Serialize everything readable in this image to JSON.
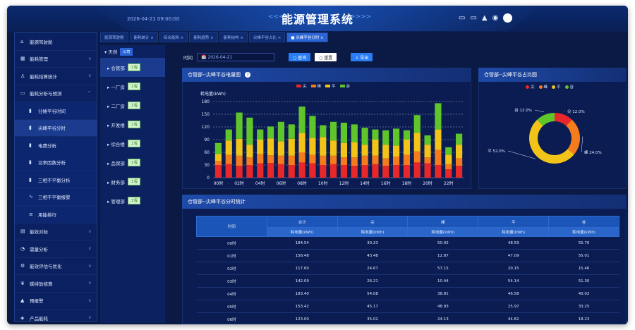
{
  "header": {
    "datetime": "2026-04-21 09:00:00",
    "title": "能源管理系统",
    "arrows_left": "<<<<",
    "arrows_right": ">>>>"
  },
  "sidebar": {
    "items": [
      {
        "label": "能源驾驶舱",
        "icon": "home-icon",
        "type": "top"
      },
      {
        "label": "能耗管理",
        "icon": "grid-icon",
        "type": "top",
        "chevron": "v"
      },
      {
        "label": "能耗结算统计",
        "icon": "user-icon",
        "type": "top",
        "chevron": "v"
      },
      {
        "label": "能耗分析与预测",
        "icon": "monitor-icon",
        "type": "top",
        "chevron": "^"
      },
      {
        "label": "分摊平谷时间",
        "icon": "bar-chart-icon",
        "type": "sub"
      },
      {
        "label": "尖峰平谷分时",
        "icon": "bar-chart-icon",
        "type": "sub",
        "active": true
      },
      {
        "label": "电费分析",
        "icon": "bar-chart-icon",
        "type": "sub"
      },
      {
        "label": "功率因数分析",
        "icon": "bar-chart-icon",
        "type": "sub"
      },
      {
        "label": "三相不平衡分析",
        "icon": "bar-chart-icon",
        "type": "sub"
      },
      {
        "label": "三相不平衡报警",
        "icon": "wave-icon",
        "type": "sub"
      },
      {
        "label": "用能排行",
        "icon": "list-icon",
        "type": "sub"
      },
      {
        "label": "能效对标",
        "icon": "book-icon",
        "type": "top",
        "chevron": "v"
      },
      {
        "label": "需量分析",
        "icon": "gauge-icon",
        "type": "top",
        "chevron": "v"
      },
      {
        "label": "能效评估与优化",
        "icon": "gear-icon",
        "type": "top",
        "chevron": "v"
      },
      {
        "label": "碳排放核算",
        "icon": "leaf-icon",
        "type": "top",
        "chevron": "v"
      },
      {
        "label": "预报警",
        "icon": "bell-icon",
        "type": "top",
        "chevron": "v"
      },
      {
        "label": "产品能耗",
        "icon": "box-icon",
        "type": "top",
        "chevron": "v"
      }
    ]
  },
  "tabs": [
    {
      "label": "能源驾驶舱"
    },
    {
      "label": "能耗统计 ×"
    },
    {
      "label": "综合能耗 ×"
    },
    {
      "label": "能耗趋势 ×"
    },
    {
      "label": "能耗结构 ×"
    },
    {
      "label": "尖峰平谷占比 ×"
    },
    {
      "label": "■ 尖峰平谷分时 ×",
      "active": true
    }
  ],
  "tree": {
    "root": {
      "label": "▾ 天然",
      "badge": "公司"
    },
    "nodes": [
      {
        "label": "▸ 仓管部",
        "badge": "工程",
        "selected": true
      },
      {
        "label": "▸ 一厂房",
        "badge": "工程"
      },
      {
        "label": "▸ 二厂房",
        "badge": "工程"
      },
      {
        "label": "▸ 开发楼",
        "badge": "工程"
      },
      {
        "label": "▸ 综合楼",
        "badge": "工程"
      },
      {
        "label": "▸ 品保部",
        "badge": "工程"
      },
      {
        "label": "▸ 财务部",
        "badge": "工程"
      },
      {
        "label": "▸ 管理部",
        "badge": "工程"
      }
    ]
  },
  "filter": {
    "label": "时间",
    "date_value": "📅 2026-04-21",
    "query_label": "○ 查询",
    "reset_label": "○ 重置",
    "export_label": "⇩ 导出"
  },
  "bar_panel": {
    "title": "仓管部--尖峰平谷电量图",
    "info_icon": "?"
  },
  "pie_panel": {
    "title": "仓管部--尖峰平谷占比图"
  },
  "table_panel": {
    "title": "仓管部--尖峰平谷分时统计"
  },
  "colors": {
    "peak": "#e8272a",
    "high": "#f57c1c",
    "flat": "#f2c418",
    "valley": "#5fc52a"
  },
  "chart_data": [
    {
      "type": "bar",
      "stacked": true,
      "ylabel": "耗电量(kWh)",
      "ylim": [
        0,
        180
      ],
      "yticks": [
        0,
        30,
        60,
        90,
        120,
        150,
        180
      ],
      "grid": true,
      "legend": "top-center",
      "categories": [
        "00时",
        "01时",
        "02时",
        "03时",
        "04时",
        "05时",
        "06时",
        "07时",
        "08时",
        "09时",
        "10时",
        "11时",
        "12时",
        "13时",
        "14时",
        "15时",
        "16时",
        "17时",
        "18时",
        "19时",
        "20时",
        "21时",
        "22时",
        "23时"
      ],
      "xtick_labels": [
        "00时",
        "02时",
        "04时",
        "06时",
        "08时",
        "10时",
        "12时",
        "14时",
        "16时",
        "18时",
        "20时",
        "22时"
      ],
      "series": [
        {
          "name": "尖",
          "values": [
            30,
            32,
            28,
            30,
            34,
            35,
            32,
            30,
            36,
            34,
            30,
            32,
            30,
            28,
            30,
            32,
            28,
            30,
            30,
            36,
            34,
            30,
            20,
            28
          ]
        },
        {
          "name": "峰",
          "values": [
            10,
            22,
            24,
            18,
            22,
            18,
            20,
            22,
            24,
            20,
            22,
            20,
            18,
            20,
            22,
            20,
            18,
            20,
            24,
            26,
            14,
            36,
            12,
            18
          ]
        },
        {
          "name": "平",
          "values": [
            16,
            34,
            40,
            30,
            34,
            40,
            34,
            40,
            46,
            40,
            44,
            36,
            34,
            36,
            26,
            38,
            32,
            26,
            36,
            44,
            30,
            48,
            22,
            32
          ]
        },
        {
          "name": "谷",
          "values": [
            26,
            26,
            62,
            64,
            24,
            28,
            46,
            34,
            62,
            52,
            28,
            44,
            48,
            42,
            40,
            24,
            34,
            40,
            22,
            42,
            22,
            62,
            18,
            26
          ]
        }
      ]
    },
    {
      "type": "pie",
      "donut": true,
      "legend": "top-center",
      "series": [
        {
          "name": "尖",
          "value": 12.0,
          "label": "尖 12.0%"
        },
        {
          "name": "峰",
          "value": 24.0,
          "label": "峰 24.0%"
        },
        {
          "name": "平",
          "value": 52.0,
          "label": "平 52.0%"
        },
        {
          "name": "谷",
          "value": 12.0,
          "label": "谷 12.0%"
        }
      ]
    },
    {
      "type": "table",
      "columns": [
        "时间",
        "合计",
        "尖",
        "峰",
        "平",
        "谷"
      ],
      "subheaders": [
        "耗电量(kWh)",
        "耗电量(kWh)",
        "耗电量(kWh)",
        "耗电量(kWh)",
        "耗电量(kWh)"
      ],
      "rows": [
        [
          "00时",
          "184.54",
          "30.23",
          "50.02",
          "48.59",
          "55.70"
        ],
        [
          "01时",
          "158.48",
          "43.48",
          "12.87",
          "47.09",
          "55.01"
        ],
        [
          "02时",
          "117.60",
          "24.67",
          "57.15",
          "20.15",
          "15.46"
        ],
        [
          "03时",
          "142.09",
          "26.21",
          "10.44",
          "54.14",
          "51.30"
        ],
        [
          "04时",
          "183.40",
          "54.08",
          "38.81",
          "46.58",
          "40.02"
        ],
        [
          "05时",
          "153.42",
          "45.17",
          "48.93",
          "25.97",
          "33.25"
        ],
        [
          "06时",
          "123.00",
          "35.02",
          "24.13",
          "44.82",
          "18.23"
        ]
      ]
    }
  ]
}
